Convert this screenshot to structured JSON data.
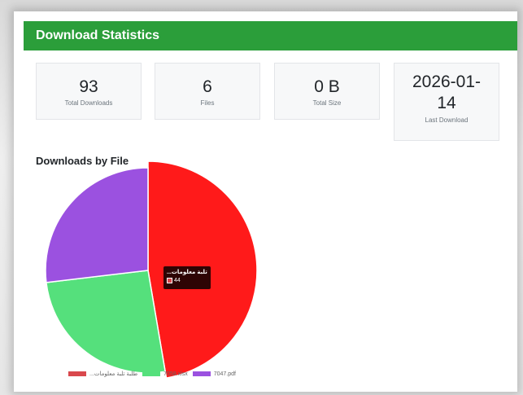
{
  "card": {
    "title": "Download Statistics"
  },
  "stats": [
    {
      "value": "93",
      "label": "Total Downloads"
    },
    {
      "value": "6",
      "label": "Files"
    },
    {
      "value": "0 B",
      "label": "Total Size"
    },
    {
      "value": "2026-01-14",
      "value_line1": "2026-01-",
      "value_line2": "14",
      "label": "Last Download"
    }
  ],
  "section": {
    "title": "Downloads by File"
  },
  "tooltip": {
    "title": "...طلبة تلبة معلومات",
    "value": "44"
  },
  "chart_data": {
    "type": "pie",
    "title": "Downloads by File",
    "categories": [
      "...طلبة تلبة معلومات",
      "7058.xlsx",
      "7047.pdf"
    ],
    "values": [
      44,
      24,
      25
    ],
    "colors": [
      "#ff1a1a",
      "#55e07c",
      "#9b51e0"
    ],
    "legend_colors": [
      "#d9484d",
      "#55e07c",
      "#9b51e0"
    ],
    "highlighted_index": 0,
    "legend_position": "bottom"
  }
}
